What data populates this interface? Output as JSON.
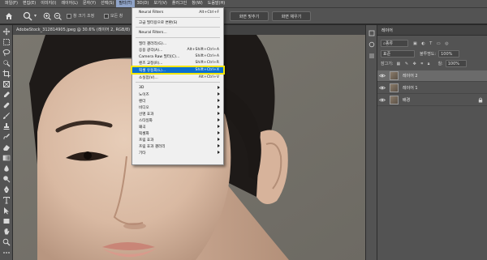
{
  "menubar": {
    "items": [
      "파일(F)",
      "편집(E)",
      "이미지(I)",
      "레이어(L)",
      "문자(Y)",
      "선택(S)",
      "필터(T)",
      "3D(D)",
      "보기(V)",
      "플러그인",
      "창(W)",
      "도움말(H)"
    ],
    "active_index": 6
  },
  "options": {
    "scroll_all_label": "창 크기 조정",
    "all_windows_label": "모든 창",
    "fit_screen_label": "화면 맞추기",
    "fill_screen_label": "화면 채우기"
  },
  "document": {
    "tab_title": "AdobeStock_312814905.jpeg @ 30.6% (레이어 2, RGB/8)"
  },
  "filter_menu": {
    "items": [
      {
        "label": "Neural Filters",
        "shortcut": "Alt+Ctrl+F"
      },
      {
        "label": "고급 필터용으로 변환(S)",
        "shortcut": ""
      },
      {
        "label": "Neural Filters...",
        "shortcut": ""
      },
      {
        "label": "필터 갤러리(G)...",
        "shortcut": ""
      },
      {
        "label": "응용 광각(A)...",
        "shortcut": "Alt+Shift+Ctrl+A"
      },
      {
        "label": "Camera Raw 필터(C)...",
        "shortcut": "Shift+Ctrl+A"
      },
      {
        "label": "렌즈 교정(R)...",
        "shortcut": "Shift+Ctrl+R"
      },
      {
        "label": "픽셀 유동화(L)...",
        "shortcut": "Shift+Ctrl+X"
      },
      {
        "label": "소실점(V)...",
        "shortcut": "Alt+Ctrl+V"
      },
      {
        "label": "3D",
        "shortcut": ""
      },
      {
        "label": "노이즈",
        "shortcut": ""
      },
      {
        "label": "렌더",
        "shortcut": ""
      },
      {
        "label": "비디오",
        "shortcut": ""
      },
      {
        "label": "선명 효과",
        "shortcut": ""
      },
      {
        "label": "스타일화",
        "shortcut": ""
      },
      {
        "label": "왜곡",
        "shortcut": ""
      },
      {
        "label": "픽셀화",
        "shortcut": ""
      },
      {
        "label": "흐림 효과",
        "shortcut": ""
      },
      {
        "label": "흐림 효과 갤러리",
        "shortcut": ""
      },
      {
        "label": "기타",
        "shortcut": ""
      }
    ],
    "highlighted_index": 7
  },
  "layers_panel": {
    "title": "레이어",
    "kind_label": "종류",
    "blend_mode": "표준",
    "opacity_label": "불투명도:",
    "opacity_value": "100%",
    "lock_label": "잠그기:",
    "fill_label": "칠:",
    "fill_value": "100%",
    "layers": [
      {
        "name": "레이어 2",
        "selected": true
      },
      {
        "name": "레이어 1",
        "selected": false
      },
      {
        "name": "배경",
        "selected": false
      }
    ]
  },
  "colors": {
    "menu_highlight": "#0a6fd0",
    "highlight_outline": "#f2e600",
    "panel_bg": "#535353"
  }
}
